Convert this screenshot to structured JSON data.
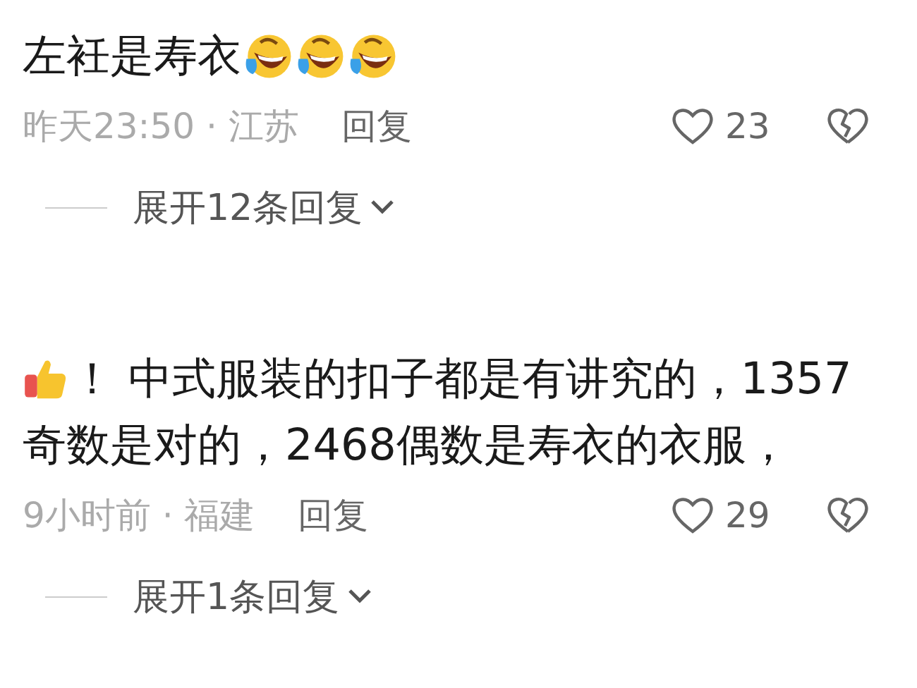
{
  "comments": [
    {
      "lines": [
        "左衽是寿衣"
      ],
      "emojis_after": [
        {
          "kind": "laughing-tears"
        },
        {
          "kind": "laughing-tears"
        },
        {
          "kind": "laughing-tears"
        }
      ],
      "time_place": "昨天23:50 · 江苏",
      "reply": "回复",
      "likes": "23",
      "expand": "展开12条回复"
    },
    {
      "lines": [
        "！ 中式服装的扣子都是有讲究的，1357",
        "奇数是对的，2468偶数是寿衣的衣服，"
      ],
      "emojis_before": [
        {
          "kind": "thumbs-up"
        }
      ],
      "time_place": "9小时前 · 福建",
      "reply": "回复",
      "likes": "29",
      "expand": "展开1条回复"
    }
  ]
}
